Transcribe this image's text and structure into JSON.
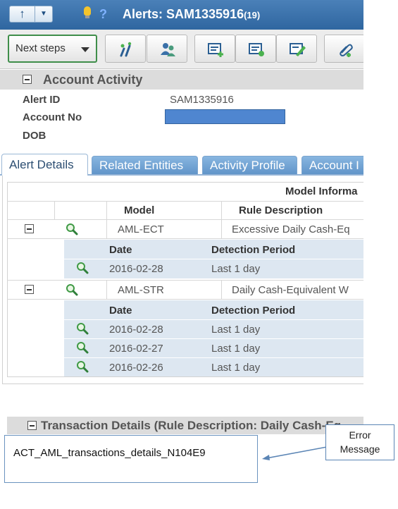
{
  "titlebar": {
    "nav_up_glyph": "↑",
    "nav_dropdown_glyph": "▼",
    "help_glyph": "?",
    "title": "Alerts: SAM1335916",
    "count": "(19)"
  },
  "toolbar": {
    "next_steps_label": "Next steps",
    "icons": [
      "escalate-icon",
      "assign-users-icon",
      "add-note-icon",
      "evidence-icon",
      "edit-icon",
      "attach-icon"
    ]
  },
  "account_activity": {
    "title": "Account Activity",
    "alert_id_label": "Alert ID",
    "alert_id_value": "SAM1335916",
    "account_no_label": "Account No",
    "dob_label": "DOB"
  },
  "tabs": [
    "Alert Details",
    "Related Entities",
    "Activity Profile",
    "Account I"
  ],
  "model_grid": {
    "group_header": "Model Informa",
    "columns": [
      "Model",
      "Rule Description"
    ],
    "rows": [
      {
        "model": "AML-ECT",
        "rule": "Excessive Daily Cash-Eq",
        "sub_columns": [
          "Date",
          "Detection Period"
        ],
        "sub_rows": [
          {
            "date": "2016-02-28",
            "period": "Last 1 day"
          }
        ]
      },
      {
        "model": "AML-STR",
        "rule": "Daily Cash-Equivalent W",
        "sub_columns": [
          "Date",
          "Detection Period"
        ],
        "sub_rows": [
          {
            "date": "2016-02-28",
            "period": "Last 1 day"
          },
          {
            "date": "2016-02-27",
            "period": "Last 1 day"
          },
          {
            "date": "2016-02-26",
            "period": "Last 1 day"
          }
        ]
      }
    ]
  },
  "transaction_details": {
    "title": "Transaction Details (Rule Description: Daily Cash-Eq"
  },
  "error": {
    "message": "ACT_AML_transactions_details_N104E9",
    "callout_line1": "Error",
    "callout_line2": "Message"
  },
  "colors": {
    "titlebar": "#2f66a0",
    "tab_inactive": "#5f93c8",
    "subgrid_bg": "#dde7f1",
    "masked_value": "#4f86d0",
    "next_steps_border": "#3f8e4a"
  }
}
